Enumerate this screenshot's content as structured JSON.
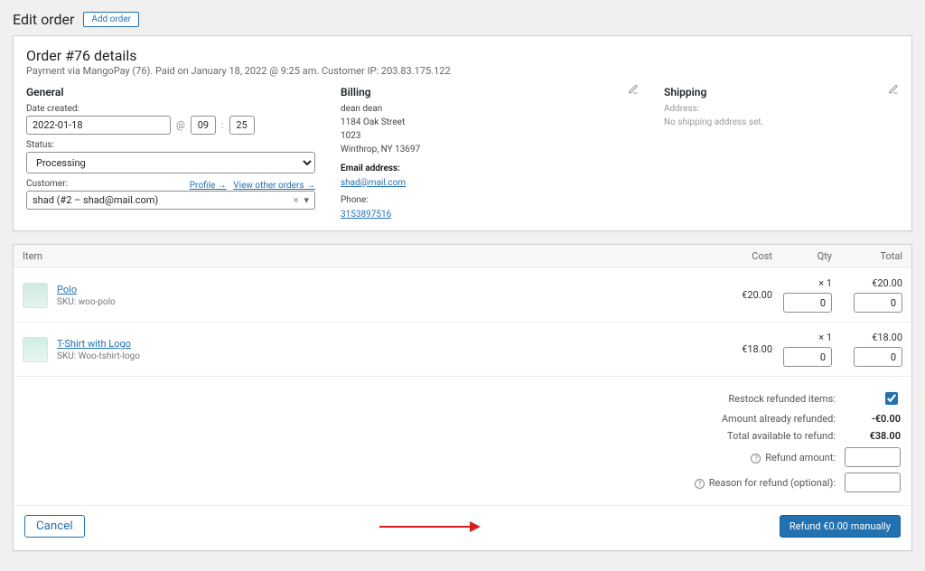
{
  "header": {
    "page_title": "Edit order",
    "add_label": "Add order"
  },
  "order": {
    "title": "Order #76 details",
    "meta": "Payment via MangoPay (76). Paid on January 18, 2022 @ 9:25 am. Customer IP: 203.83.175.122"
  },
  "general": {
    "heading": "General",
    "date_label": "Date created:",
    "date_value": "2022-01-18",
    "hour_value": "09",
    "min_value": "25",
    "at": "@",
    "sep": ":",
    "status_label": "Status:",
    "status_value": "Processing",
    "customer_label": "Customer:",
    "customer_value": "shad (#2 – shad@mail.com)",
    "profile_link": "Profile",
    "view_orders_link": "View other orders"
  },
  "billing": {
    "heading": "Billing",
    "lines": [
      "dean dean",
      "1184 Oak Street",
      "1023",
      "Winthrop, NY 13697"
    ],
    "email_label": "Email address:",
    "email_value": "shad@mail.com",
    "phone_label": "Phone:",
    "phone_value": "3153897516"
  },
  "shipping": {
    "heading": "Shipping",
    "address_label": "Address:",
    "empty_text": "No shipping address set."
  },
  "items_header": {
    "item": "Item",
    "cost": "Cost",
    "qty": "Qty",
    "total": "Total"
  },
  "items": [
    {
      "name": "Polo",
      "sku_prefix": "SKU: ",
      "sku": "woo-polo",
      "cost": "€20.00",
      "qty": "× 1",
      "qty_input": "0",
      "total": "€20.00",
      "total_input": "0"
    },
    {
      "name": "T-Shirt with Logo",
      "sku_prefix": "SKU: ",
      "sku": "Woo-tshirt-logo",
      "cost": "€18.00",
      "qty": "× 1",
      "qty_input": "0",
      "total": "€18.00",
      "total_input": "0"
    }
  ],
  "totals": {
    "restock_label": "Restock refunded items:",
    "already_label": "Amount already refunded:",
    "already_value": "-€0.00",
    "available_label": "Total available to refund:",
    "available_value": "€38.00",
    "refund_amount_label": "Refund amount:",
    "refund_reason_label": "Reason for refund (optional):"
  },
  "footer": {
    "cancel": "Cancel",
    "refund": "Refund €0.00 manually"
  }
}
